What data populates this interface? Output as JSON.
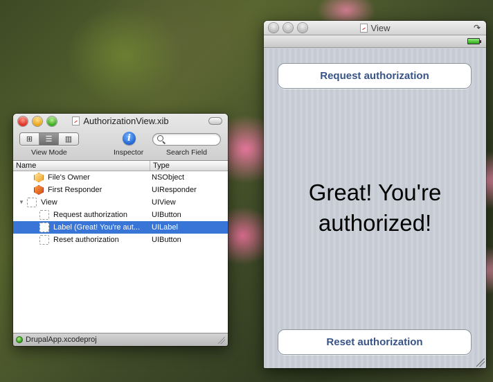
{
  "xib_window": {
    "title": "AuthorizationView.xib",
    "toolbar": {
      "view_mode_label": "View Mode",
      "inspector_label": "Inspector",
      "search_label": "Search Field",
      "search_placeholder": ""
    },
    "columns": {
      "name": "Name",
      "type": "Type"
    },
    "rows": [
      {
        "name": "File's Owner",
        "type": "NSObject",
        "icon": "cube-icon"
      },
      {
        "name": "First Responder",
        "type": "UIResponder",
        "icon": "responder-icon"
      },
      {
        "name": "View",
        "type": "UIView",
        "icon": "view-icon",
        "expanded": true
      },
      {
        "name": "Request authorization",
        "type": "UIButton",
        "icon": "view-icon"
      },
      {
        "name": "Label (Great! You're aut...",
        "type": "UILabel",
        "icon": "view-icon",
        "selected": true
      },
      {
        "name": "Reset authorization",
        "type": "UIButton",
        "icon": "view-icon"
      }
    ],
    "status": "DrupalApp.xcodeproj"
  },
  "view_window": {
    "title": "View",
    "request_button": "Request authorization",
    "label_text": "Great! You're authorized!",
    "reset_button": "Reset authorization"
  },
  "colors": {
    "selection": "#3875d7",
    "ios_button_text": "#385487"
  }
}
